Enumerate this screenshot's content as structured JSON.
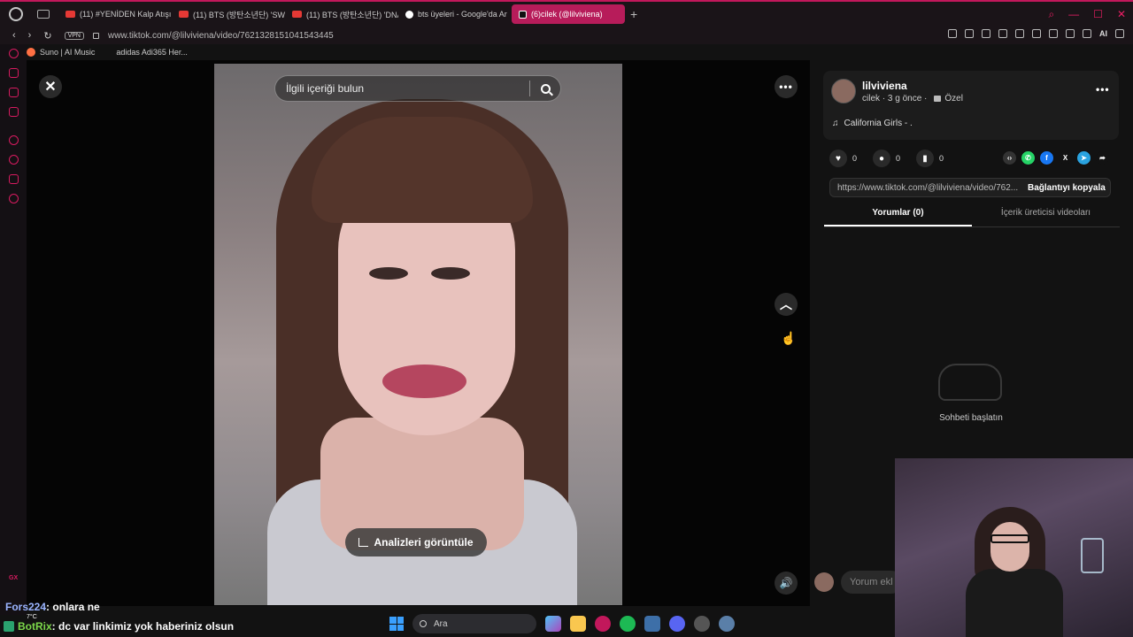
{
  "browser": {
    "tabs": [
      {
        "label": "(11) #YENİDEN Kalp Atışı 5",
        "icon": "youtube-icon",
        "active": false
      },
      {
        "label": "(11) BTS (방탄소년단) 'SWI",
        "icon": "youtube-icon",
        "active": false
      },
      {
        "label": "(11) BTS (방탄소년단) 'DNA",
        "icon": "youtube-icon",
        "active": false
      },
      {
        "label": "bts üyeleri - Google'da Ar",
        "icon": "google-icon",
        "active": false
      },
      {
        "label": "(6)cilek (@lilviviena)",
        "icon": "tiktok-icon",
        "active": true
      }
    ],
    "vpn_label": "VPN",
    "url": "www.tiktok.com/@lilviviena/video/7621328151041543445",
    "ai_label": "AI",
    "bookmarks": [
      "Suno | AI Music",
      "adidas Adi365 Her..."
    ],
    "sidebar_gx": "GX"
  },
  "video": {
    "search_placeholder": "İlgili içeriği bulun",
    "analytics_label": "Analizleri görüntüle"
  },
  "panel": {
    "author_name": "lilviviena",
    "author_meta": "cilek · 3 g önce ·",
    "privacy": "Özel",
    "music": "California Girls - .",
    "likes": "0",
    "comments": "0",
    "saves": "0",
    "link_url": "https://www.tiktok.com/@lilviviena/video/762...",
    "copy_link_label": "Bağlantıyı kopyala",
    "tab_comments": "Yorumlar (0)",
    "tab_creator": "İçerik üreticisi videoları",
    "empty_text": "Sohbeti başlatın",
    "comment_placeholder": "Yorum ekl"
  },
  "chat": {
    "line1_user": "Fors224",
    "line1_text": ": onlara ne",
    "line2_user": "BotRix",
    "line2_text": ": dc var linkimiz yok haberiniz olsun",
    "weather": "7°C"
  },
  "taskbar": {
    "search_label": "Ara"
  },
  "colors": {
    "accent": "#c2185b",
    "tiktok_tab": "#b71c5a",
    "whatsapp": "#25d366",
    "facebook": "#1877f2",
    "telegram": "#2aa3e0"
  }
}
